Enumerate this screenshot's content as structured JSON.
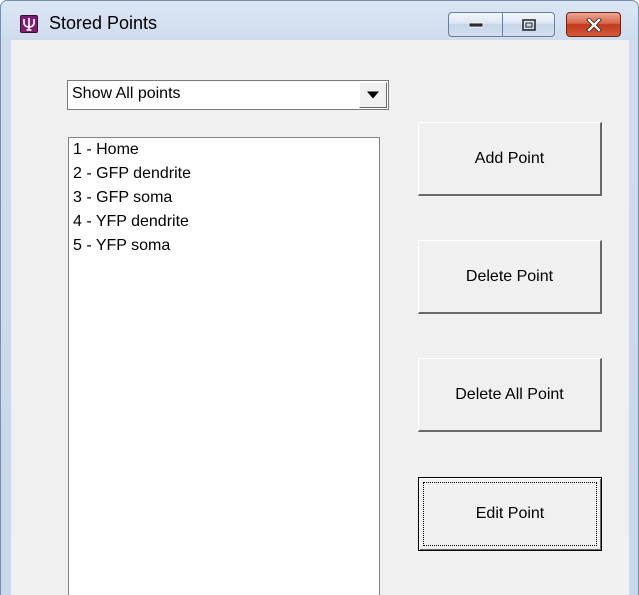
{
  "window": {
    "title": "Stored Points",
    "icon": "psi-app-icon",
    "buttons": {
      "minimize": "minimize-icon",
      "maximize": "maximize-icon",
      "close": "close-icon"
    }
  },
  "filter": {
    "selected": "Show All points"
  },
  "points": [
    "1 - Home",
    "2 - GFP dendrite",
    "3 - GFP soma",
    "4 - YFP dendrite",
    "5 - YFP soma"
  ],
  "actions": {
    "add": "Add Point",
    "delete": "Delete Point",
    "delete_all": "Delete All Point",
    "edit": "Edit Point"
  },
  "colors": {
    "close_button": "#c2381d",
    "app_icon": "#7b1f6e"
  }
}
